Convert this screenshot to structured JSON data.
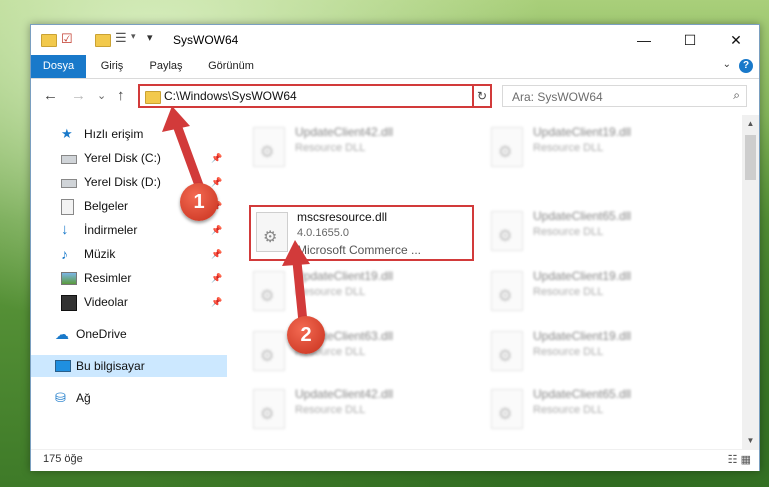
{
  "window": {
    "title": "SysWOW64",
    "minimize": "—",
    "maximize": "☐",
    "close": "✕"
  },
  "ribbon": {
    "tabs": [
      {
        "label": "Dosya"
      },
      {
        "label": "Giriş"
      },
      {
        "label": "Paylaş"
      },
      {
        "label": "Görünüm"
      }
    ],
    "help": "?"
  },
  "nav": {
    "back": "←",
    "forward": "→",
    "recent": "⌄",
    "up": "↑",
    "address": "C:\\Windows\\SysWOW64",
    "search_placeholder": "Ara: SysWOW64"
  },
  "sidebar": {
    "items": [
      {
        "label": "Hızlı erişim",
        "icon": "star-icon",
        "pinned": false
      },
      {
        "label": "Yerel Disk (C:)",
        "icon": "drive-icon",
        "pinned": true
      },
      {
        "label": "Yerel Disk (D:)",
        "icon": "drive-icon",
        "pinned": true
      },
      {
        "label": "Belgeler",
        "icon": "documents-icon",
        "pinned": true
      },
      {
        "label": "İndirmeler",
        "icon": "download-icon",
        "pinned": true
      },
      {
        "label": "Müzik",
        "icon": "music-icon",
        "pinned": true
      },
      {
        "label": "Resimler",
        "icon": "pictures-icon",
        "pinned": true
      },
      {
        "label": "Videolar",
        "icon": "video-icon",
        "pinned": true
      },
      {
        "label": "OneDrive",
        "icon": "cloud-icon",
        "pinned": false
      },
      {
        "label": "Bu bilgisayar",
        "icon": "computer-icon",
        "pinned": false
      },
      {
        "label": "Ağ",
        "icon": "network-icon",
        "pinned": false
      }
    ]
  },
  "files": [
    {
      "name": "UpdateClient42.dll",
      "desc": "Resource DLL",
      "extra": ""
    },
    {
      "name": "UpdateClient19.dll",
      "desc": "Resource DLL",
      "extra": ""
    },
    {
      "name": "mscsresource.dll",
      "desc": "4.0.1655.0",
      "extra": "Microsoft Commerce ..."
    },
    {
      "name": "UpdateClient65.dll",
      "desc": "Resource DLL",
      "extra": ""
    },
    {
      "name": "UpdateClient19.dll",
      "desc": "Resource DLL",
      "extra": ""
    },
    {
      "name": "UpdateClient19.dll",
      "desc": "Resource DLL",
      "extra": ""
    },
    {
      "name": "UpdateClient63.dll",
      "desc": "Resource DLL",
      "extra": ""
    },
    {
      "name": "UpdateClient19.dll",
      "desc": "Resource DLL",
      "extra": ""
    },
    {
      "name": "UpdateClient42.dll",
      "desc": "Resource DLL",
      "extra": ""
    },
    {
      "name": "UpdateClient65.dll",
      "desc": "Resource DLL",
      "extra": ""
    }
  ],
  "status": {
    "count": "175 öğe"
  },
  "annotations": {
    "step1": "1",
    "step2": "2",
    "color": "#d23a3a"
  }
}
